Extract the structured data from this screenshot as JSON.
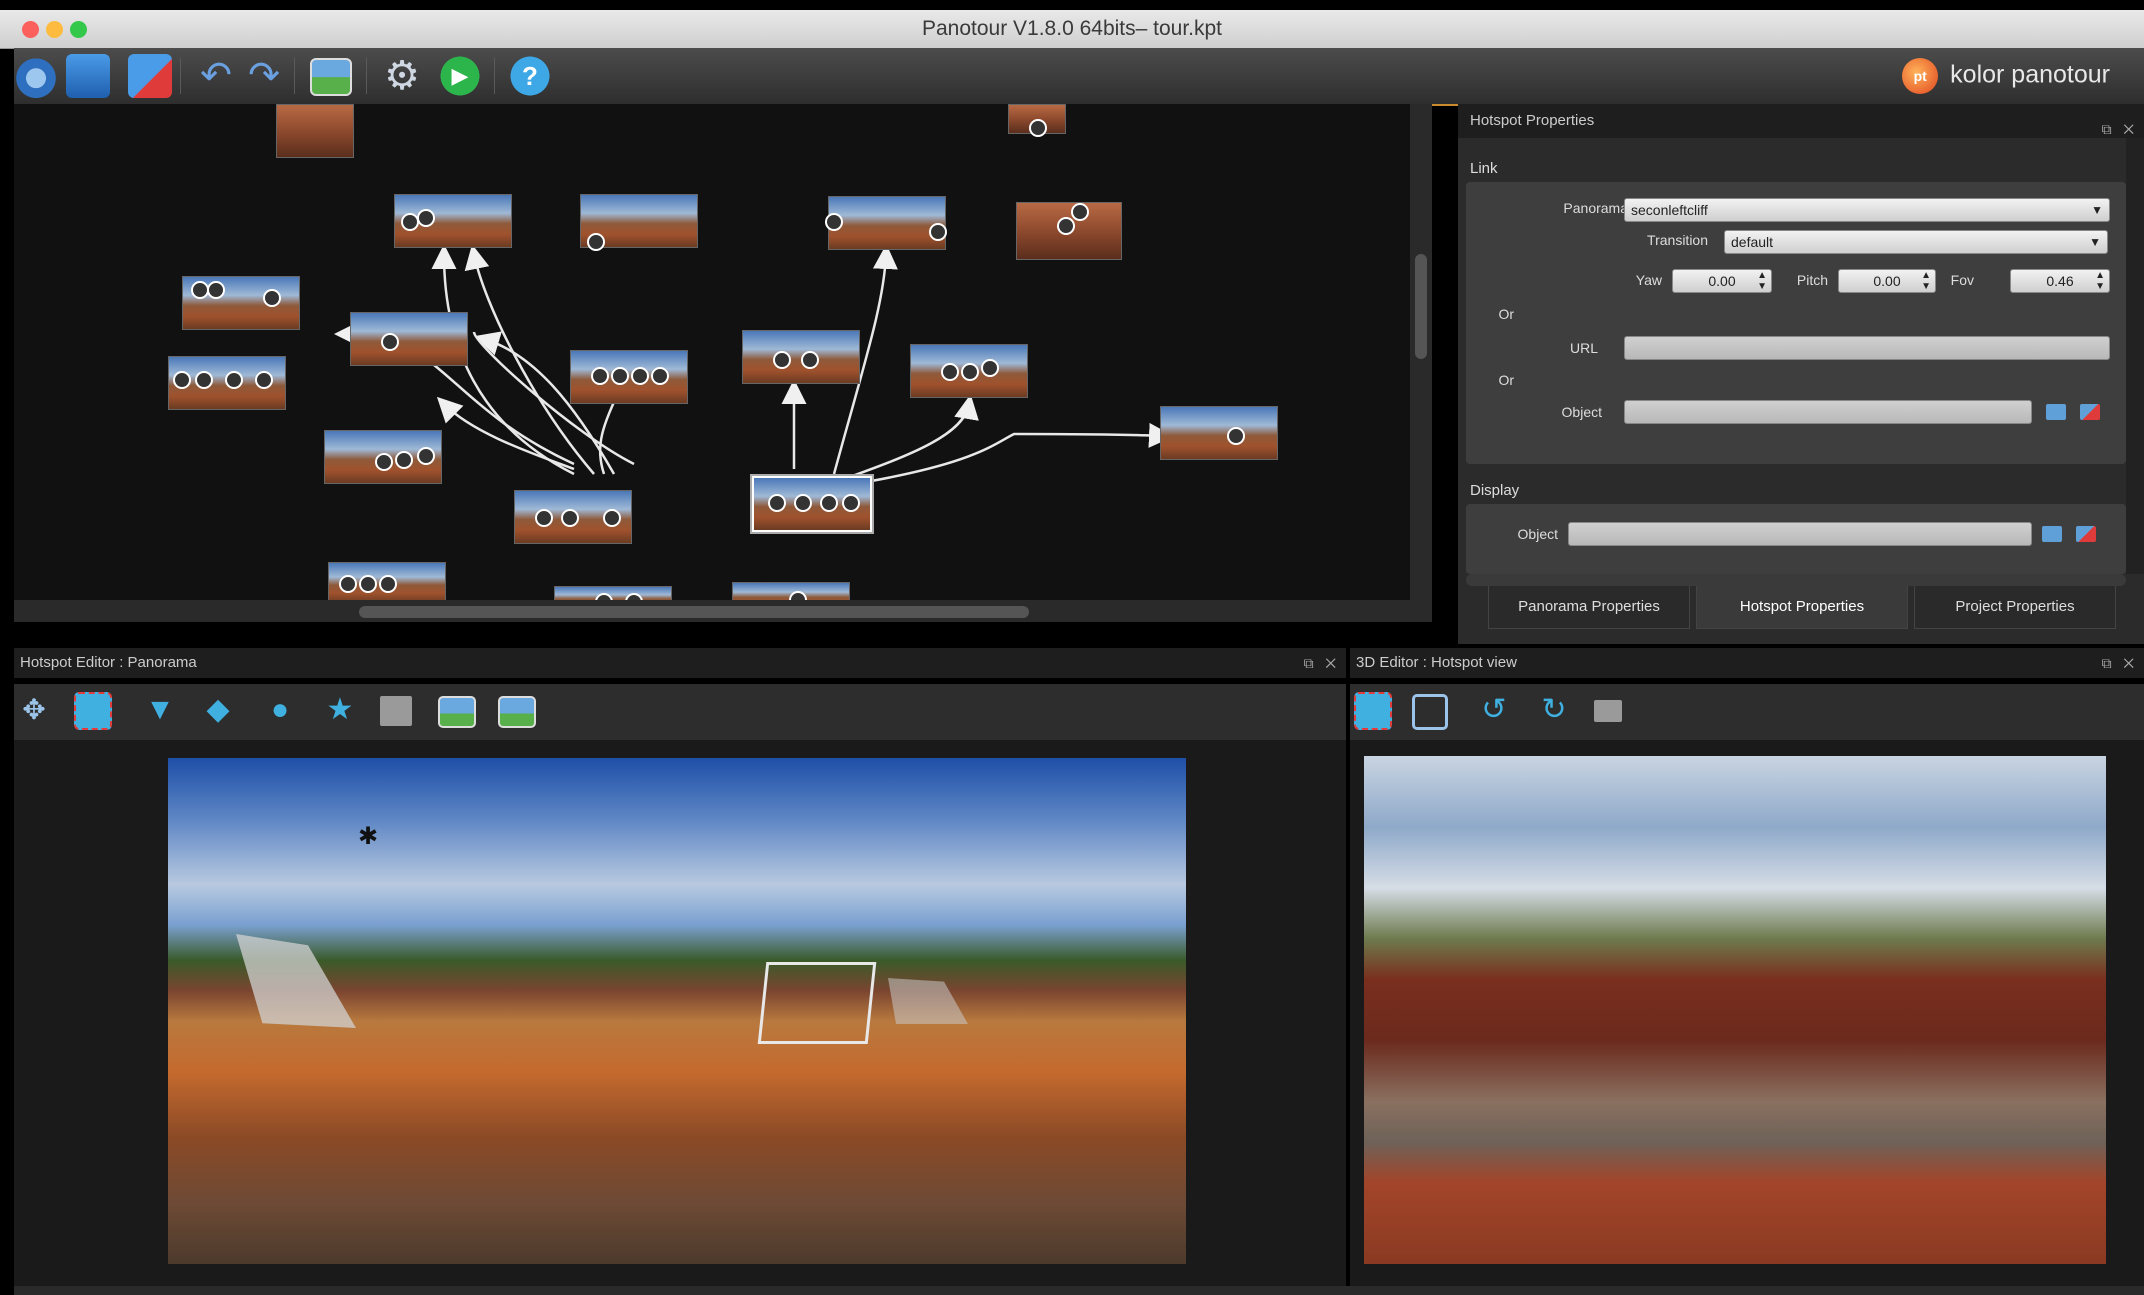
{
  "window": {
    "title": "Panotour V1.8.0 64bits– tour.kpt",
    "colors": {
      "close": "#fc605c",
      "minimize": "#fdbc40",
      "zoom": "#34c84a"
    }
  },
  "toolbar": {
    "brand": "kolor panotour",
    "brand_logo": "pt",
    "items": [
      {
        "name": "open-project-icon",
        "color": "#3b8de0"
      },
      {
        "name": "save-icon",
        "color": "#3b8de0"
      },
      {
        "name": "close-project-icon",
        "color": "#e03b3b"
      },
      {
        "name": "undo-icon",
        "color": "#6aa0e0"
      },
      {
        "name": "redo-icon",
        "color": "#6aa0e0"
      },
      {
        "name": "add-panorama-icon",
        "color": "#58b04a"
      },
      {
        "name": "settings-gear-icon",
        "color": "#cfd7e3"
      },
      {
        "name": "build-play-icon",
        "color": "#2cb54a"
      },
      {
        "name": "help-icon",
        "color": "#3ea7e6"
      }
    ]
  },
  "hotspot_properties": {
    "title": "Hotspot Properties",
    "link_section": "Link",
    "panorama_label": "Panorama",
    "panorama_value": "seconleftcliff",
    "transition_label": "Transition",
    "transition_value": "default",
    "yaw_label": "Yaw",
    "yaw_value": "0.00",
    "pitch_label": "Pitch",
    "pitch_value": "0.00",
    "fov_label": "Fov",
    "fov_value": "0.46",
    "or_label_1": "Or",
    "url_label": "URL",
    "url_value": "",
    "or_label_2": "Or",
    "object_label": "Object",
    "object_value": "",
    "display_section": "Display",
    "display_object_label": "Object",
    "display_object_value": "",
    "tabs": [
      "Panorama Properties",
      "Hotspot Properties",
      "Project Properties"
    ],
    "active_tab": "Hotspot Properties"
  },
  "hotspot_editor": {
    "title": "Hotspot Editor : Panorama",
    "tools": [
      {
        "name": "select-move-tool-icon",
        "color": "#9cc4ea"
      },
      {
        "name": "select-area-tool-icon",
        "color": "#e23b3b"
      },
      {
        "name": "add-point-hotspot-icon",
        "color": "#3fb0e0"
      },
      {
        "name": "add-polygon-hotspot-icon",
        "color": "#3fb0e0"
      },
      {
        "name": "add-circle-hotspot-icon",
        "color": "#3fb0e0"
      },
      {
        "name": "add-star-hotspot-icon",
        "color": "#3fb0e0"
      },
      {
        "name": "add-image-hotspot-icon",
        "color": "#9a9a9a"
      },
      {
        "name": "add-picture-hotspot-icon",
        "color": "#5fa0d8"
      },
      {
        "name": "add-picture-variant-icon",
        "color": "#5fa0d8"
      }
    ]
  },
  "editor_3d": {
    "title": "3D Editor : Hotspot view",
    "tools": [
      {
        "name": "select-area-tool-icon",
        "color": "#e23b3b"
      },
      {
        "name": "view-frame-icon",
        "color": "#9cc4ea"
      },
      {
        "name": "rotate-left-view-icon",
        "color": "#3fb0e0"
      },
      {
        "name": "rotate-right-view-icon",
        "color": "#3fb0e0"
      },
      {
        "name": "image-menu-icon",
        "color": "#9a9a9a"
      }
    ]
  }
}
